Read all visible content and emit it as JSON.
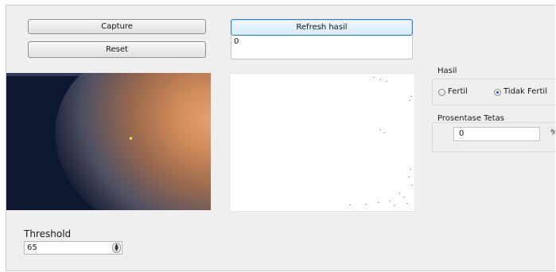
{
  "buttons": {
    "capture": "Capture",
    "reset": "Reset",
    "refresh": "Refresh hasil"
  },
  "result_box": {
    "value": "0"
  },
  "hasil": {
    "title": "Hasil",
    "options": [
      {
        "label": "Fertil",
        "checked": false
      },
      {
        "label": "Tidak Fertil",
        "checked": true
      }
    ]
  },
  "prosentase": {
    "title": "Prosentase Tetas",
    "value": "0",
    "unit": "%"
  },
  "threshold": {
    "label": "Threshold",
    "value": "65"
  },
  "icons": {
    "spin": "spin-arrows-icon",
    "radio_checked": "radio-checked-icon",
    "radio_unchecked": "radio-unchecked-icon"
  },
  "colors": {
    "focused_button_border": "#3c7fb1",
    "window_bg": "#efefef",
    "camera_bg": "#0e1730"
  }
}
